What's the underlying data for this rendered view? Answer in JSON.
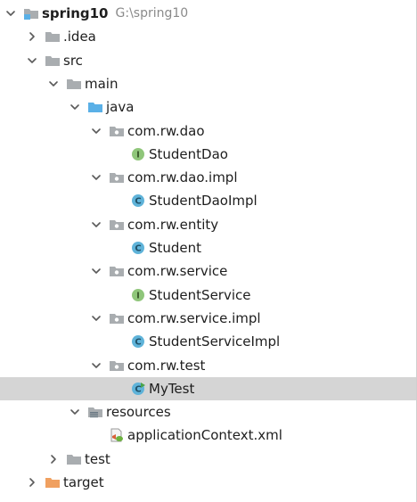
{
  "tree": [
    {
      "label": "spring10",
      "path": "G:\\spring10",
      "depth": 0,
      "expanded": true,
      "arrow": "down",
      "icon": "module-folder-icon",
      "bold": true
    },
    {
      "label": ".idea",
      "depth": 1,
      "arrow": "right",
      "icon": "folder-icon"
    },
    {
      "label": "src",
      "depth": 1,
      "arrow": "down",
      "icon": "folder-icon"
    },
    {
      "label": "main",
      "depth": 2,
      "arrow": "down",
      "icon": "folder-icon"
    },
    {
      "label": "java",
      "depth": 3,
      "arrow": "down",
      "icon": "source-folder-icon"
    },
    {
      "label": "com.rw.dao",
      "depth": 4,
      "arrow": "down",
      "icon": "package-icon"
    },
    {
      "label": "StudentDao",
      "depth": 5,
      "arrow": "none",
      "icon": "interface-icon"
    },
    {
      "label": "com.rw.dao.impl",
      "depth": 4,
      "arrow": "down",
      "icon": "package-icon"
    },
    {
      "label": "StudentDaoImpl",
      "depth": 5,
      "arrow": "none",
      "icon": "class-icon"
    },
    {
      "label": "com.rw.entity",
      "depth": 4,
      "arrow": "down",
      "icon": "package-icon"
    },
    {
      "label": "Student",
      "depth": 5,
      "arrow": "none",
      "icon": "class-icon"
    },
    {
      "label": "com.rw.service",
      "depth": 4,
      "arrow": "down",
      "icon": "package-icon"
    },
    {
      "label": "StudentService",
      "depth": 5,
      "arrow": "none",
      "icon": "interface-icon"
    },
    {
      "label": "com.rw.service.impl",
      "depth": 4,
      "arrow": "down",
      "icon": "package-icon"
    },
    {
      "label": "StudentServiceImpl",
      "depth": 5,
      "arrow": "none",
      "icon": "class-icon"
    },
    {
      "label": "com.rw.test",
      "depth": 4,
      "arrow": "down",
      "icon": "package-icon"
    },
    {
      "label": "MyTest",
      "depth": 5,
      "arrow": "none",
      "icon": "runnable-class-icon",
      "selected": true
    },
    {
      "label": "resources",
      "depth": 3,
      "arrow": "down",
      "icon": "resources-folder-icon"
    },
    {
      "label": "applicationContext.xml",
      "depth": 4,
      "arrow": "none",
      "icon": "spring-xml-icon"
    },
    {
      "label": "test",
      "depth": 2,
      "arrow": "right",
      "icon": "folder-icon"
    },
    {
      "label": "target",
      "depth": 1,
      "arrow": "right",
      "icon": "excluded-folder-icon"
    }
  ],
  "colors": {
    "folder": "#a9adb0",
    "source_folder": "#5ab0e6",
    "excluded_folder": "#f0a060",
    "interface_badge": "#8fc67a",
    "class_badge": "#5fb3d9",
    "selection": "#d5d5d5",
    "path_text": "#8a8a8a"
  }
}
